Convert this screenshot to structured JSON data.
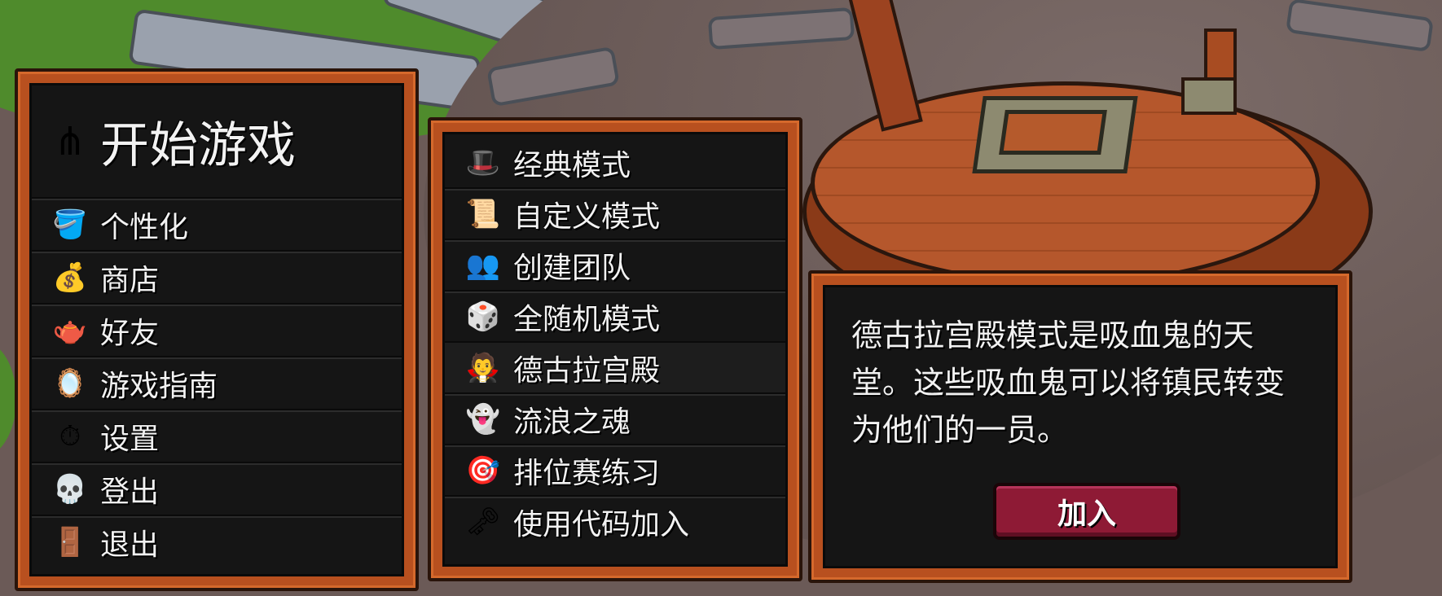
{
  "main_menu": {
    "title": "开始游戏",
    "title_icon": "pitchfork-icon",
    "items": [
      {
        "label": "个性化",
        "icon": "paint-bucket-icon"
      },
      {
        "label": "商店",
        "icon": "coin-bag-icon"
      },
      {
        "label": "好友",
        "icon": "teapot-icon"
      },
      {
        "label": "游戏指南",
        "icon": "mirror-icon"
      },
      {
        "label": "设置",
        "icon": "pocket-watch-icon"
      },
      {
        "label": "登出",
        "icon": "skull-icon"
      },
      {
        "label": "退出",
        "icon": "exit-door-icon"
      }
    ]
  },
  "mode_menu": {
    "items": [
      {
        "label": "经典模式",
        "icon": "pilgrim-hat-icon"
      },
      {
        "label": "自定义模式",
        "icon": "scroll-icon"
      },
      {
        "label": "创建团队",
        "icon": "team-icon"
      },
      {
        "label": "全随机模式",
        "icon": "dice-icon"
      },
      {
        "label": "德古拉宫殿",
        "icon": "vampire-icon"
      },
      {
        "label": "流浪之魂",
        "icon": "ghost-icon"
      },
      {
        "label": "排位赛练习",
        "icon": "target-icon"
      },
      {
        "label": "使用代码加入",
        "icon": "keys-icon"
      }
    ]
  },
  "info_panel": {
    "description": "德古拉宫殿模式是吸血鬼的天堂。这些吸血鬼可以将镇民转变为他们的一员。",
    "join_label": "加入"
  },
  "colors": {
    "frame": "#b8501f",
    "panel_bg": "#151515",
    "join_button": "#8e1a35"
  }
}
